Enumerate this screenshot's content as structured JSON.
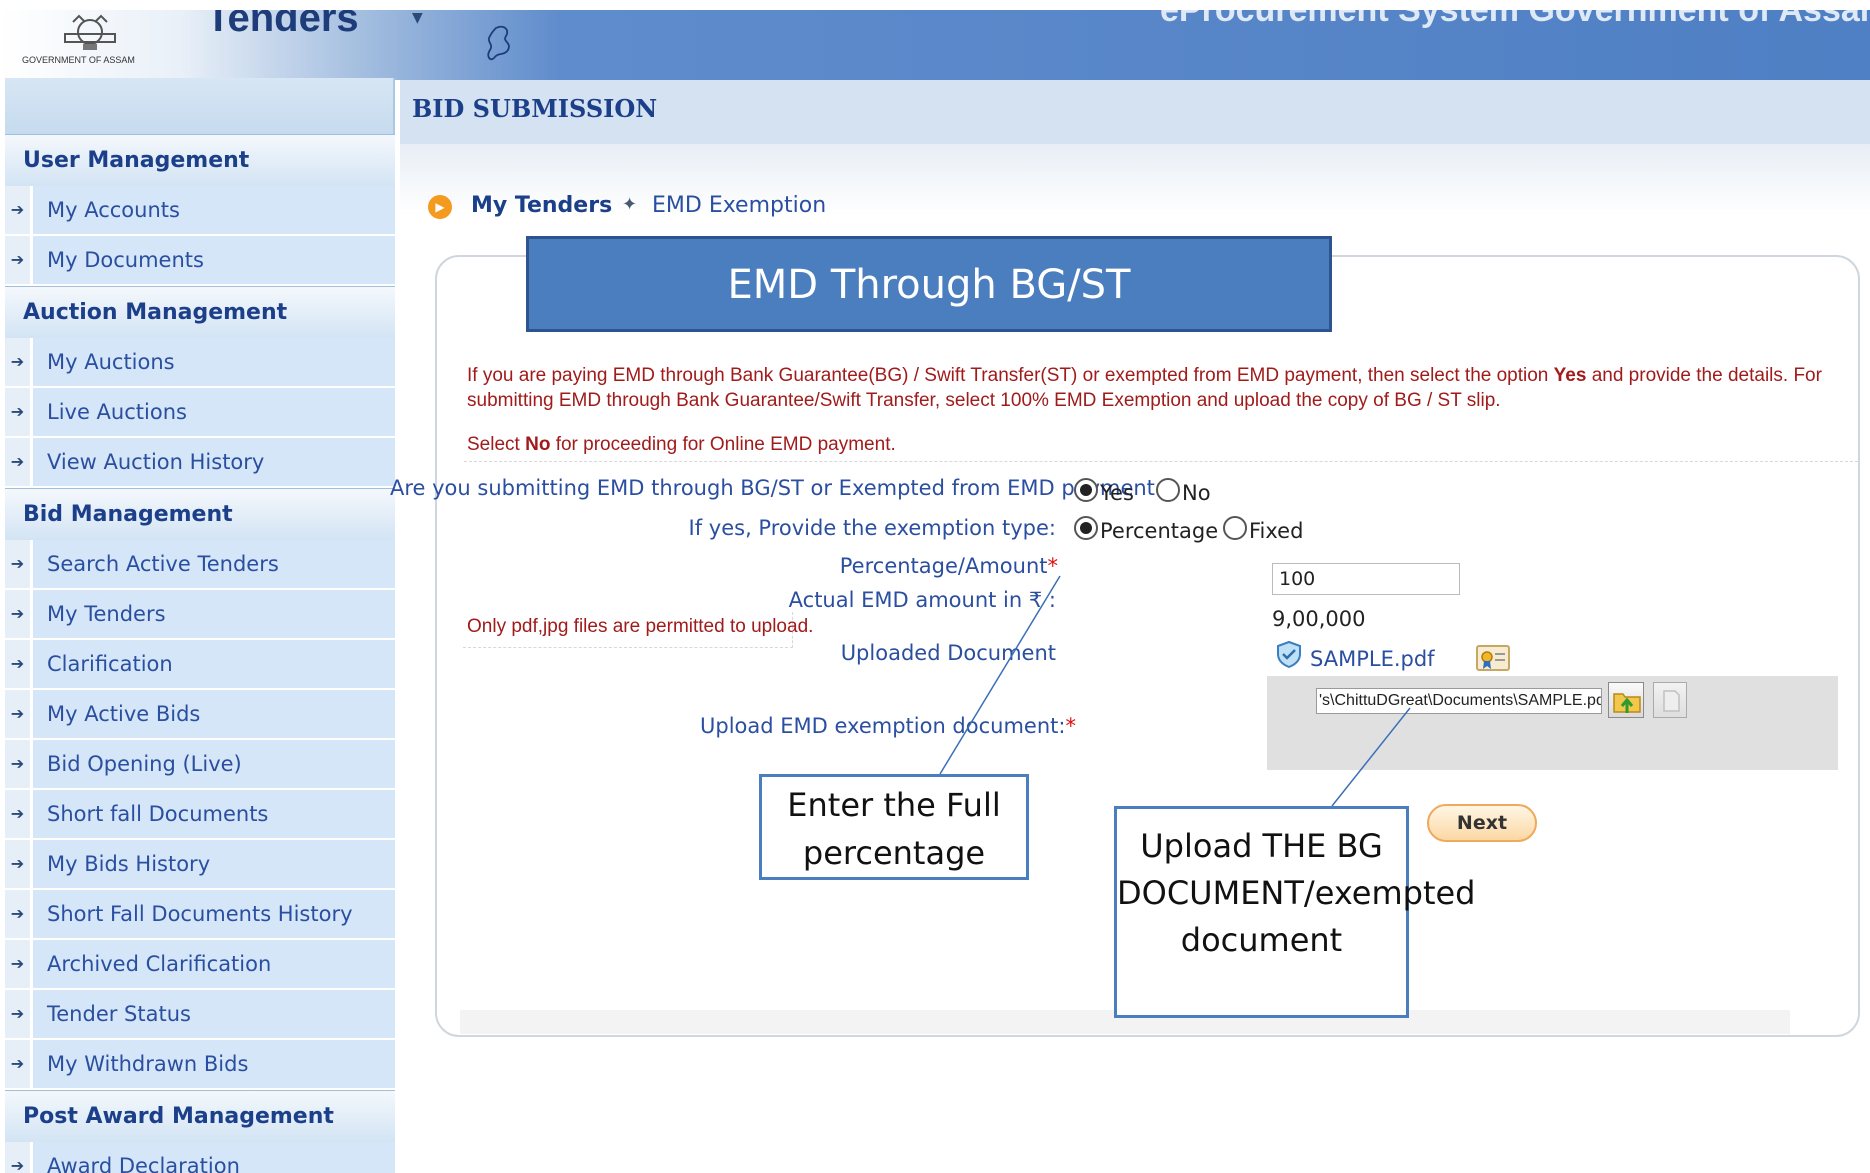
{
  "header": {
    "brand_title": "Tenders",
    "gov_text": "GOVERNMENT OF ASSAM",
    "system_title": "eProcurement System Government of Assam",
    "dropdown_glyph": "▼"
  },
  "sidebar": {
    "groups": [
      {
        "label": "User Management",
        "items": [
          {
            "label": "My Accounts"
          },
          {
            "label": "My Documents"
          }
        ]
      },
      {
        "label": "Auction Management",
        "items": [
          {
            "label": "My Auctions"
          },
          {
            "label": "Live Auctions"
          },
          {
            "label": "View Auction History"
          }
        ]
      },
      {
        "label": "Bid Management",
        "items": [
          {
            "label": "Search Active Tenders"
          },
          {
            "label": "My Tenders"
          },
          {
            "label": "Clarification"
          },
          {
            "label": "My Active Bids"
          },
          {
            "label": "Bid Opening (Live)"
          },
          {
            "label": "Short fall Documents"
          },
          {
            "label": "My Bids History"
          },
          {
            "label": "Short Fall Documents History"
          },
          {
            "label": "Archived Clarification"
          },
          {
            "label": "Tender Status"
          },
          {
            "label": "My Withdrawn Bids"
          }
        ]
      },
      {
        "label": "Post Award Management",
        "items": [
          {
            "label": "Award Declaration"
          }
        ]
      }
    ]
  },
  "main": {
    "section_title": "BID SUBMISSION",
    "breadcrumb": {
      "parent": "My Tenders",
      "separator": "✦",
      "current": "EMD Exemption"
    },
    "callout_title": "EMD Through BG/ST",
    "info": {
      "line1_pre": "If you are paying EMD through Bank Guarantee(BG) / Swift Transfer(ST) or exempted from EMD payment, then select the option ",
      "line1_bold": "Yes",
      "line1_post": " and provide the details. For submitting EMD through Bank Guarantee/Swift Transfer, select 100% EMD Exemption and upload the copy of BG / ST slip.",
      "line2_pre": "Select ",
      "line2_bold": "No",
      "line2_post": " for proceeding for Online EMD payment."
    },
    "form": {
      "question_label": "Are you submitting EMD through BG/ST or Exempted from EMD payment:",
      "yes_label": "Yes",
      "no_label": "No",
      "exemption_type_label": "If yes, Provide the exemption type:",
      "percentage_label": "Percentage",
      "fixed_label": "Fixed",
      "pct_amount_label": "Percentage/Amount",
      "required_mark": "*",
      "pct_amount_value": "100",
      "actual_emd_label": "Actual EMD amount in ₹ :",
      "actual_emd_value": "9,00,000",
      "file_types_note": "Only pdf,jpg files are permitted to upload.",
      "uploaded_doc_label": "Uploaded Document",
      "uploaded_doc_name": "SAMPLE.pdf",
      "upload_label": "Upload EMD exemption document:",
      "file_path_value": "'s\\ChittuDGreat\\Documents\\SAMPLE.pdf",
      "next_label": "Next"
    },
    "annotations": {
      "callout1": "Enter the Full percentage",
      "callout2": "Upload THE BG DOCUMENT/exempted document"
    }
  },
  "colors": {
    "primary_blue": "#1c3f8a",
    "link_blue": "#2b4fa0",
    "warning_red": "#a11b1b",
    "callout_fill": "#4a7ebf",
    "next_button": "#fbd8a4"
  }
}
